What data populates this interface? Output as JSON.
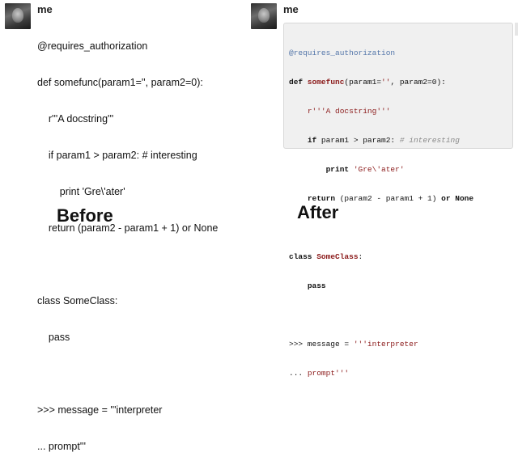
{
  "before": {
    "username": "me",
    "code_lines": [
      "@requires_authorization",
      "def somefunc(param1='', param2=0):",
      "    r'''A docstring'''",
      "    if param1 > param2: # interesting",
      "        print 'Gre\\'ater'",
      "    return (param2 - param1 + 1) or None",
      "",
      "class SomeClass:",
      "    pass",
      "",
      ">>> message = '''interpreter",
      "... prompt'''"
    ],
    "caption": "Before"
  },
  "after": {
    "username": "me",
    "caption": "After",
    "tokens": {
      "decorator": "@requires_authorization",
      "def_kw": "def",
      "func_name": " somefunc",
      "params_start": "(param1=",
      "empty_str": "''",
      "params_end": ", param2=0):",
      "docstring": "r'''A docstring'''",
      "if_kw": "if",
      "condition": " param1 > param2: ",
      "comment": "# interesting",
      "print_kw": "print",
      "print_str": " 'Gre\\'ater'",
      "return_kw": "return",
      "return_expr": " (param2 - param1 + 1) ",
      "or_kw": "or",
      "none_kw": " None",
      "class_kw": "class",
      "class_name": " SomeClass",
      "colon": ":",
      "pass_kw": "pass",
      "prompt1": ">>> message = ",
      "interp_str1": "'''interpreter",
      "prompt2": "... ",
      "interp_str2": "prompt'''"
    }
  }
}
